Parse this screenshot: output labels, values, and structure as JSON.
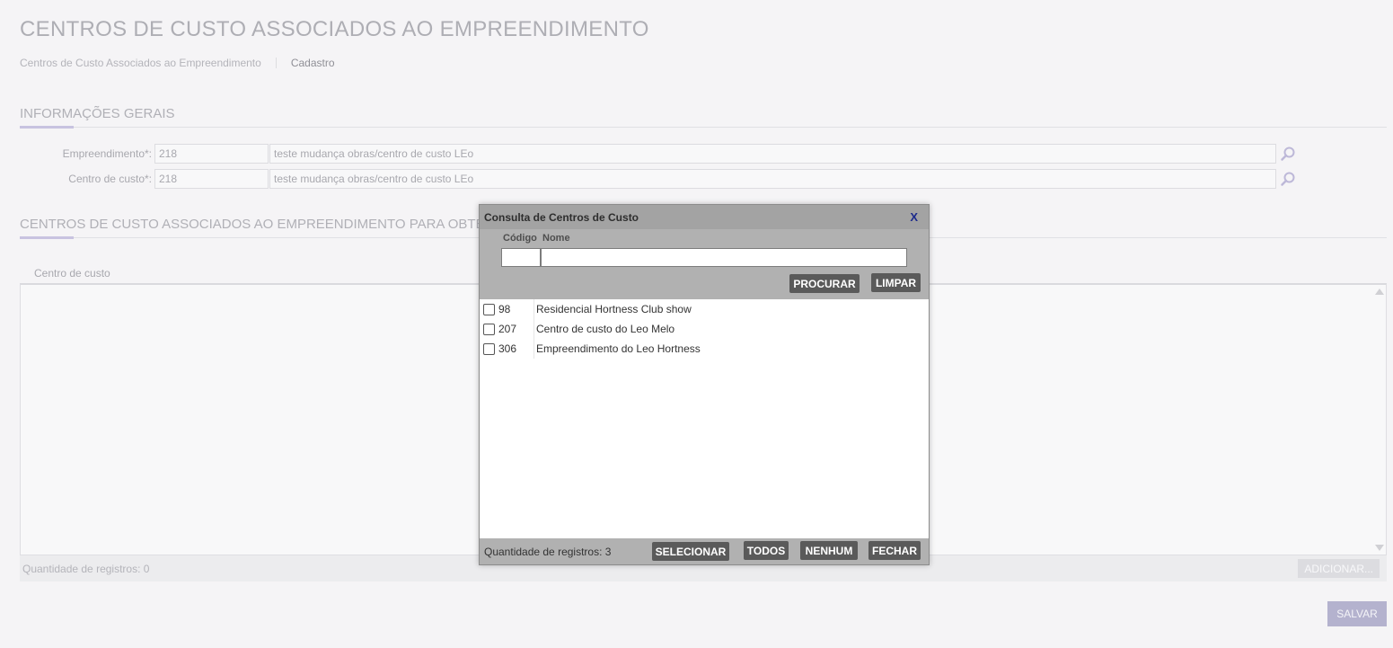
{
  "page": {
    "title": "CENTROS DE CUSTO ASSOCIADOS AO EMPREENDIMENTO",
    "breadcrumb": [
      "Centros de Custo Associados ao Empreendimento",
      "Cadastro"
    ]
  },
  "general_section": {
    "title": "INFORMAÇÕES GERAIS",
    "empreendimento": {
      "label": "Empreendimento*:",
      "code": "218",
      "name": "teste mudança obras/centro de custo LEo"
    },
    "centro_custo": {
      "label": "Centro de custo*:",
      "code": "218",
      "name": "teste mudança obras/centro de custo LEo"
    }
  },
  "assoc_section": {
    "title": "CENTROS DE CUSTO ASSOCIADOS AO EMPREENDIMENTO PARA OBTENÇÃO",
    "column_header": "Centro de custo",
    "record_count": "Quantidade de registros: 0",
    "add_label": "ADICIONAR...",
    "save_label": "SALVAR"
  },
  "modal": {
    "title": "Consulta de Centros de Custo",
    "close_label": "X",
    "code_label": "Código",
    "name_label": "Nome",
    "code_value": "",
    "name_value": "",
    "search_label": "PROCURAR",
    "clear_label": "LIMPAR",
    "rows": [
      {
        "code": "98",
        "name": "Residencial Hortness Club show"
      },
      {
        "code": "207",
        "name": "Centro de custo do Leo Melo"
      },
      {
        "code": "306",
        "name": "Empreendimento do Leo Hortness"
      }
    ],
    "record_count": "Quantidade de registros: 3",
    "select_label": "SELECIONAR",
    "all_label": "TODOS",
    "none_label": "NENHUM",
    "close_button_label": "FECHAR"
  },
  "colors": {
    "accent": "#c8c3e0",
    "modal_button": "#5a5a5a",
    "close_x": "#1d2b8c"
  }
}
